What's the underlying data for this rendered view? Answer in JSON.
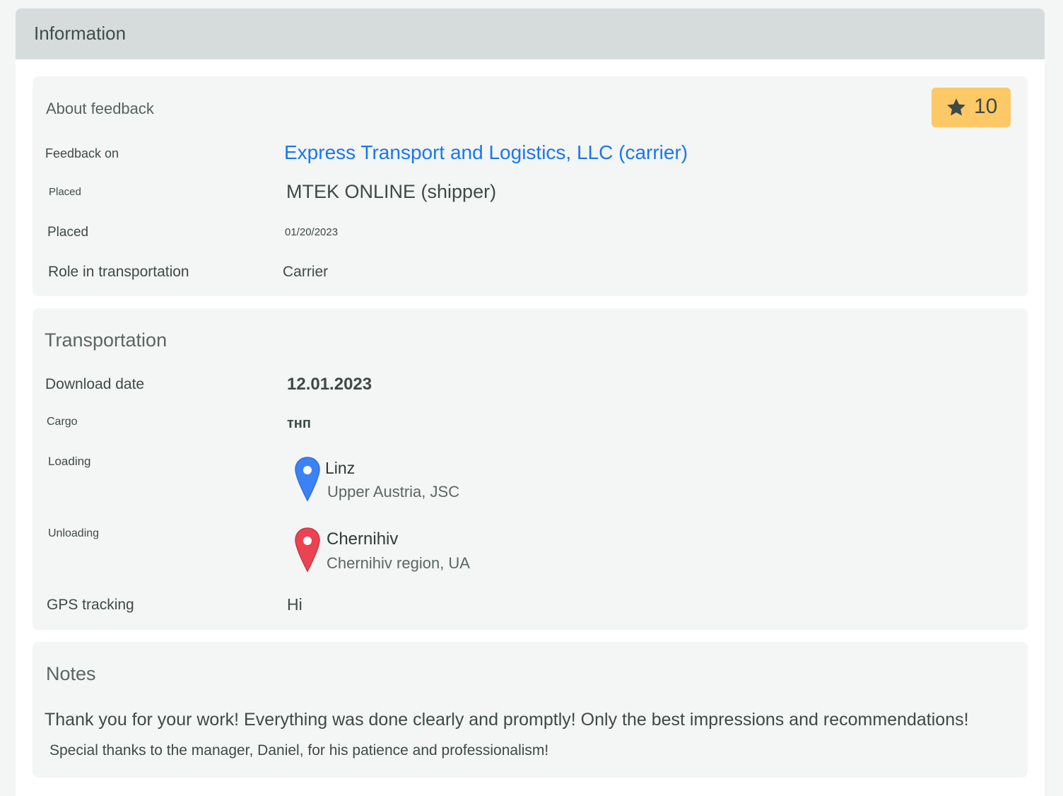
{
  "header": {
    "title": "Information"
  },
  "about": {
    "title": "About feedback",
    "rating": "10",
    "rows": {
      "feedback_on": {
        "label": "Feedback on",
        "value": "Express Transport and Logistics, LLC (carrier)"
      },
      "placed_by": {
        "label": "Placed",
        "value": "MTEK ONLINE (shipper)"
      },
      "placed_date": {
        "label": "Placed",
        "value": "01/20/2023"
      },
      "role": {
        "label": "Role in transportation",
        "value": "Carrier"
      }
    }
  },
  "transport": {
    "title": "Transportation",
    "rows": {
      "download_date": {
        "label": "Download date",
        "value": "12.01.2023"
      },
      "cargo": {
        "label": "Cargo",
        "value": "тнп"
      },
      "loading": {
        "label": "Loading",
        "city": "Linz",
        "region": "Upper Austria, JSC"
      },
      "unloading": {
        "label": "Unloading",
        "city": "Chernihiv",
        "region": "Chernihiv region, UA"
      },
      "gps": {
        "label": "GPS tracking",
        "value": "Hi"
      }
    }
  },
  "notes": {
    "title": "Notes",
    "line1": "Thank you for your work! Everything was done clearly and promptly! Only the best impressions and recommendations!",
    "line2": "Special thanks to the manager, Daniel, for his patience and professionalism!"
  },
  "colors": {
    "accent_link": "#1877f2",
    "rating_badge": "#fdc866",
    "loading_pin": "#3b82f6",
    "unloading_pin": "#ea4452"
  },
  "icons": {
    "rating": "star-icon",
    "loading": "map-pin-blue-icon",
    "unloading": "map-pin-red-icon"
  }
}
